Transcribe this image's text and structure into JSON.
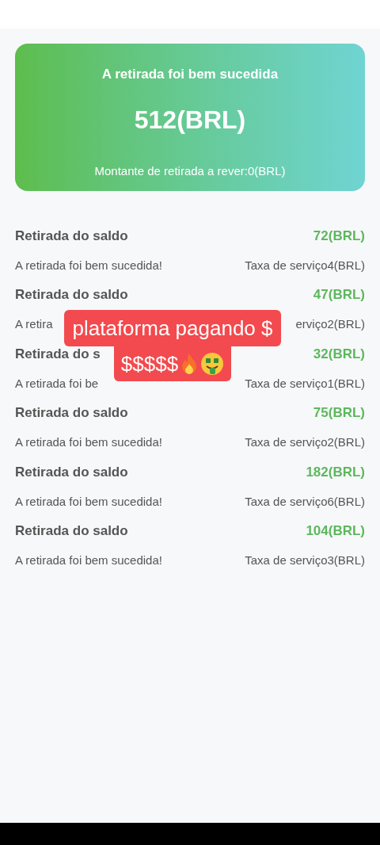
{
  "summary": {
    "title": "A retirada foi bem sucedida",
    "amount": "512(BRL)",
    "pending": "Montante de retirada a rever:0(BRL)"
  },
  "records": [
    {
      "title": "Retirada do saldo",
      "amount": "72(BRL)",
      "status": "A retirada foi bem sucedida!",
      "fee": "Taxa de serviço4(BRL)"
    },
    {
      "title": "Retirada do saldo",
      "amount": "47(BRL)",
      "status": "A retira",
      "fee": "erviço2(BRL)"
    },
    {
      "title": "Retirada do s",
      "amount": "32(BRL)",
      "status": "A retirada foi be",
      "fee": "Taxa de serviço1(BRL)"
    },
    {
      "title": "Retirada do saldo",
      "amount": "75(BRL)",
      "status": "A retirada foi bem sucedida!",
      "fee": "Taxa de serviço2(BRL)"
    },
    {
      "title": "Retirada do saldo",
      "amount": "182(BRL)",
      "status": "A retirada foi bem sucedida!",
      "fee": "Taxa de serviço6(BRL)"
    },
    {
      "title": "Retirada do saldo",
      "amount": "104(BRL)",
      "status": "A retirada foi bem sucedida!",
      "fee": "Taxa de serviço3(BRL)"
    }
  ],
  "caption": {
    "line_1": "plataforma pagando $",
    "line_2": "$$$$$"
  }
}
